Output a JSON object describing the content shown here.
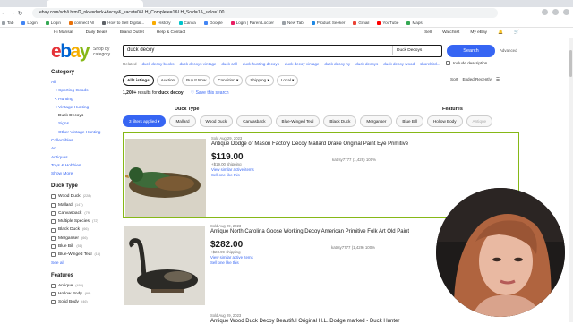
{
  "browser": {
    "url": "ebay.com/sch/i.html?_nkw=duck+decoy&_sacat=0&LH_Complete=1&LH_Sold=1&_udlo=100",
    "bookmarks": [
      "Tab",
      "Login",
      "Login",
      "connect All",
      "How to Sell Digital...",
      "History",
      "Canva",
      "Google",
      "Login | ParentLocker",
      "New Tab",
      "Product Seeker",
      "Gmail",
      "YouTube",
      "Maps"
    ]
  },
  "header": {
    "greeting": "Hi Marisa!",
    "daily_deals": "Daily Deals",
    "brand_outlet": "Brand Outlet",
    "help": "Help & Contact",
    "sell": "Sell",
    "watchlist": "Watchlist",
    "my_ebay": "My eBay"
  },
  "logo": {
    "e": "e",
    "b": "b",
    "a": "a",
    "y": "y"
  },
  "shop_by": "Shop by category",
  "search": {
    "query": "duck decoy",
    "category": "Duck Decoys",
    "button": "Search",
    "advanced": "Advanced"
  },
  "related": {
    "label": "Related",
    "terms": [
      "duck decoy books",
      "duck decoys vintage",
      "duck call",
      "duck hunting decoys",
      "duck decoy vintage",
      "duck decoy ny",
      "duck decoys",
      "duck decoy wood",
      "shorebird..."
    ]
  },
  "include_description": "Include description",
  "sidebar": {
    "category_title": "Category",
    "categories": [
      {
        "label": "All",
        "level": 0
      },
      {
        "label": "< Sporting Goods",
        "level": 1
      },
      {
        "label": "< Hunting",
        "level": 1
      },
      {
        "label": "< Vintage Hunting",
        "level": 1
      },
      {
        "label": "Duck Decoys",
        "level": 2
      },
      {
        "label": "Signs",
        "level": 2
      },
      {
        "label": "Other Vintage Hunting",
        "level": 2
      },
      {
        "label": "Collectibles",
        "level": 0
      },
      {
        "label": "Art",
        "level": 0
      },
      {
        "label": "Antiques",
        "level": 0
      },
      {
        "label": "Toys & Hobbies",
        "level": 0
      }
    ],
    "show_more": "Show More",
    "duck_type_title": "Duck Type",
    "duck_types": [
      {
        "label": "Wood Duck",
        "count": "(228)"
      },
      {
        "label": "Mallard",
        "count": "(147)"
      },
      {
        "label": "Canvasback",
        "count": "(79)"
      },
      {
        "label": "Multiple Species",
        "count": "(72)"
      },
      {
        "label": "Black Duck",
        "count": "(66)"
      },
      {
        "label": "Merganser",
        "count": "(66)"
      },
      {
        "label": "Blue Bill",
        "count": "(51)"
      },
      {
        "label": "Blue-Winged Teal",
        "count": "(16)"
      }
    ],
    "see_all": "See all",
    "features_title": "Features",
    "features": [
      {
        "label": "Antique",
        "count": "(495)"
      },
      {
        "label": "Hollow Body",
        "count": "(98)"
      },
      {
        "label": "Solid Body",
        "count": "(46)"
      }
    ]
  },
  "tabs": [
    "All Listings",
    "Auction",
    "Buy It Now",
    "Condition",
    "Shipping",
    "Local"
  ],
  "sort": {
    "label": "Sort",
    "value": "Ended Recently"
  },
  "results_count": {
    "number": "1,200+",
    "mid": "results for",
    "query": "duck decoy",
    "save": "Save this search"
  },
  "filter_heads": {
    "duck_type": "Duck Type",
    "features": "Features"
  },
  "chips": {
    "applied": "3 filters applied",
    "items": [
      "Mallard",
      "Wood Duck",
      "Canvasback",
      "Blue-Winged Teal",
      "Black Duck",
      "Merganser",
      "Blue Bill"
    ],
    "features": [
      "Hollow Body",
      "Antique"
    ]
  },
  "listings": [
    {
      "sold": "Sold Aug 29, 2023",
      "title": "Antique Dodge or Mason Factory Decoy Mallard Drake Original Paint Eye Primitive",
      "price": "$119.00",
      "shipping": "+$19.00 shipping",
      "similar": "View similar active items",
      "sell_one": "Sell one like this",
      "seller": "katrsy7777 (1,429) 100%"
    },
    {
      "sold": "Sold Aug 29, 2023",
      "title": "Antique North Carolina Goose Working Decoy American Primitive Folk Art Old Paint",
      "price": "$282.00",
      "shipping": "+$23.99 shipping",
      "similar": "View similar active items",
      "sell_one": "Sell one like this",
      "seller": "katrsy7777 (1,429) 100%"
    },
    {
      "sold": "Sold Aug 29, 2023",
      "title": "Antique Wood Duck Decoy Beautiful Original H.L. Dodge marked - Duck Hunter",
      "price": "",
      "shipping": "",
      "similar": "",
      "sell_one": "",
      "seller": ""
    }
  ],
  "colors": {
    "accent": "#3665f3",
    "highlight_border": "#86b817"
  }
}
